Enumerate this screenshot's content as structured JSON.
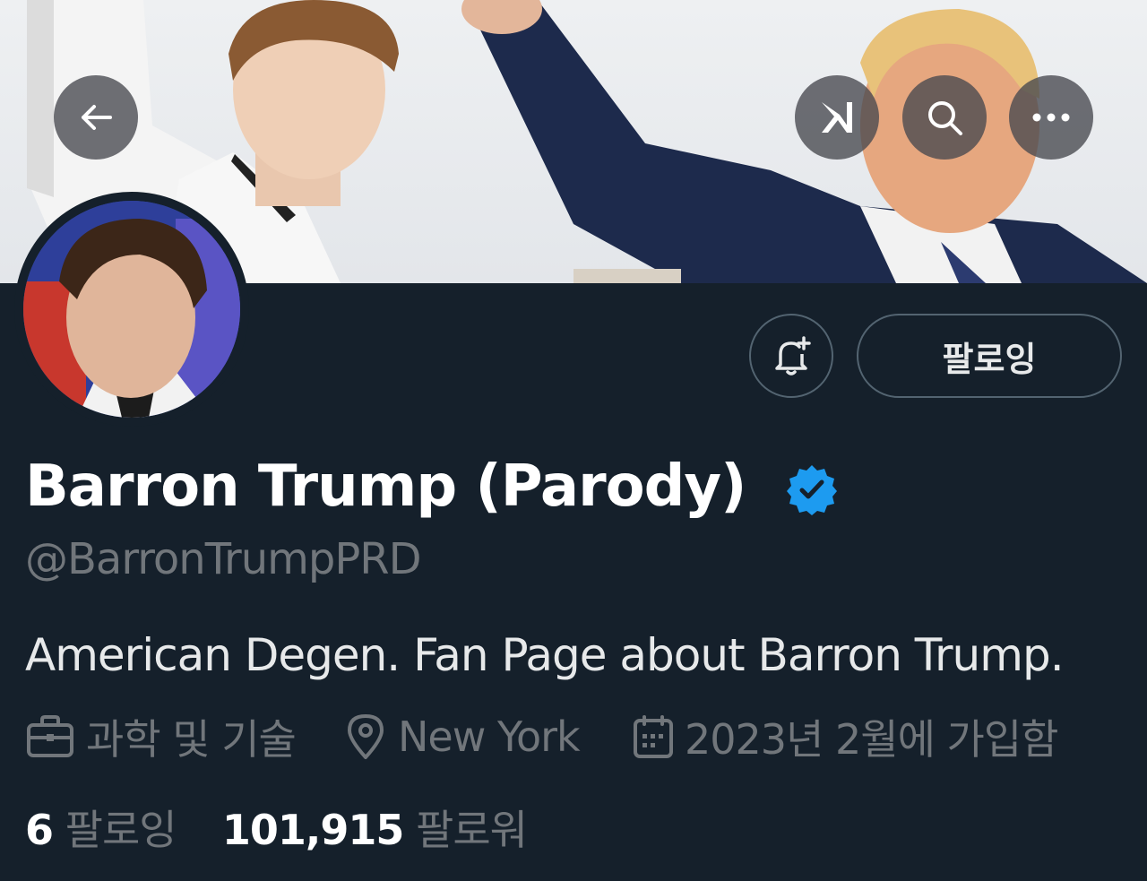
{
  "header": {
    "back_icon": "arrow-left-icon",
    "grok_icon": "grok-icon",
    "search_icon": "search-icon",
    "more_icon": "more-horizontal-icon"
  },
  "profile": {
    "display_name": "Barron Trump (Parody)",
    "handle": "@BarronTrumpPRD",
    "bio": "American Degen. Fan Page about Barron Trump.",
    "category": "과학 및 기술",
    "location": "New York",
    "joined": "2023년 2월에 가입함",
    "following_count": "6",
    "following_label": "팔로잉",
    "followers_count": "101,915",
    "followers_label": "팔로워"
  },
  "actions": {
    "follow_label": "팔로잉",
    "notify_icon": "bell-plus-icon"
  },
  "colors": {
    "background": "#15202b",
    "verified": "#1d9bf0",
    "secondary_text": "#71767b"
  }
}
